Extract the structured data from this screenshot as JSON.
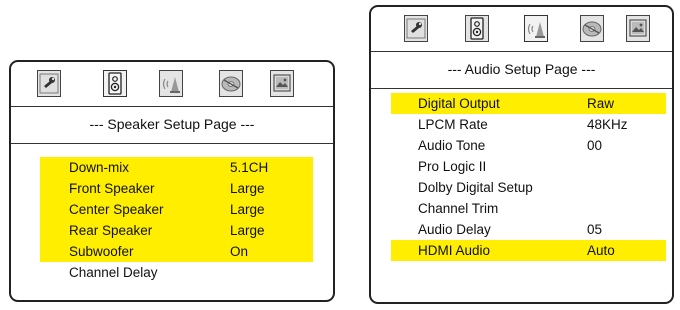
{
  "speaker_panel": {
    "title": "--- Speaker Setup Page ---",
    "tabs": [
      {
        "icon": "wrench-icon",
        "selected": false
      },
      {
        "icon": "speaker-icon",
        "selected": true
      },
      {
        "icon": "audio-wave-icon",
        "selected": false
      },
      {
        "icon": "disc-icon",
        "selected": false
      },
      {
        "icon": "picture-icon",
        "selected": false
      }
    ],
    "items": [
      {
        "label": "Down-mix",
        "value": "5.1CH",
        "highlighted": true
      },
      {
        "label": "Front Speaker",
        "value": "Large",
        "highlighted": true
      },
      {
        "label": "Center Speaker",
        "value": "Large",
        "highlighted": true
      },
      {
        "label": "Rear Speaker",
        "value": "Large",
        "highlighted": true
      },
      {
        "label": "Subwoofer",
        "value": "On",
        "highlighted": true
      },
      {
        "label": "Channel Delay",
        "value": "",
        "highlighted": false
      }
    ]
  },
  "audio_panel": {
    "title": "--- Audio Setup Page ---",
    "tabs": [
      {
        "icon": "wrench-icon",
        "selected": false
      },
      {
        "icon": "speaker-icon",
        "selected": false
      },
      {
        "icon": "audio-wave-icon",
        "selected": true
      },
      {
        "icon": "disc-icon",
        "selected": false
      },
      {
        "icon": "picture-icon",
        "selected": false
      }
    ],
    "items": [
      {
        "label": "Digital Output",
        "value": "Raw",
        "highlighted": true
      },
      {
        "label": "LPCM Rate",
        "value": "48KHz",
        "highlighted": false
      },
      {
        "label": "Audio Tone",
        "value": "00",
        "highlighted": false
      },
      {
        "label": "Pro Logic II",
        "value": "",
        "highlighted": false
      },
      {
        "label": "Dolby Digital Setup",
        "value": "",
        "highlighted": false
      },
      {
        "label": "Channel Trim",
        "value": "",
        "highlighted": false
      },
      {
        "label": "Audio Delay",
        "value": "05",
        "highlighted": false
      },
      {
        "label": "HDMI Audio",
        "value": "Auto",
        "highlighted": true
      }
    ]
  },
  "colors": {
    "highlight": "#ffee00",
    "border": "#222222"
  }
}
